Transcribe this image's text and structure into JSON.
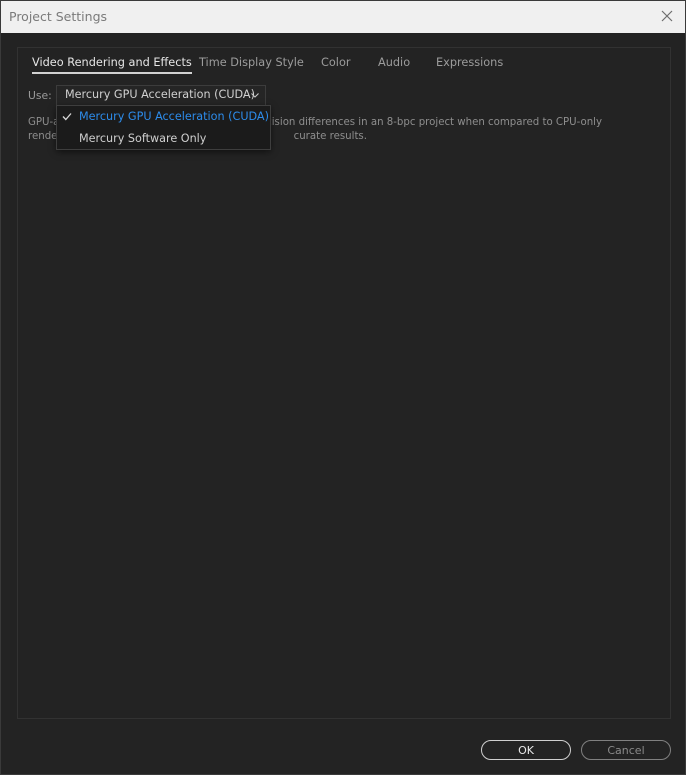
{
  "window": {
    "title": "Project Settings"
  },
  "tabs": [
    {
      "label": "Video Rendering and Effects",
      "active": true
    },
    {
      "label": "Time Display Style",
      "active": false
    },
    {
      "label": "Color",
      "active": false
    },
    {
      "label": "Audio",
      "active": false
    },
    {
      "label": "Expressions",
      "active": false
    }
  ],
  "renderer": {
    "label": "Use:",
    "value": "Mercury GPU Acceleration (CUDA)",
    "options": [
      {
        "label": "Mercury GPU Acceleration (CUDA)",
        "selected": true
      },
      {
        "label": "Mercury Software Only",
        "selected": false
      }
    ]
  },
  "description": {
    "line1_prefix": "GPU-a",
    "line1_suffix": "precision differences in an 8-bpc project when compared to CPU-only",
    "line2_prefix": "render",
    "line2_suffix": "curate results."
  },
  "buttons": {
    "ok": "OK",
    "cancel": "Cancel"
  },
  "colors": {
    "accent_selected": "#2d8ceb",
    "background": "#232323",
    "titlebar": "#f0f0f0"
  },
  "icons": {
    "close": "close-icon",
    "chevron": "chevron-down-icon",
    "check": "checkmark-icon"
  }
}
